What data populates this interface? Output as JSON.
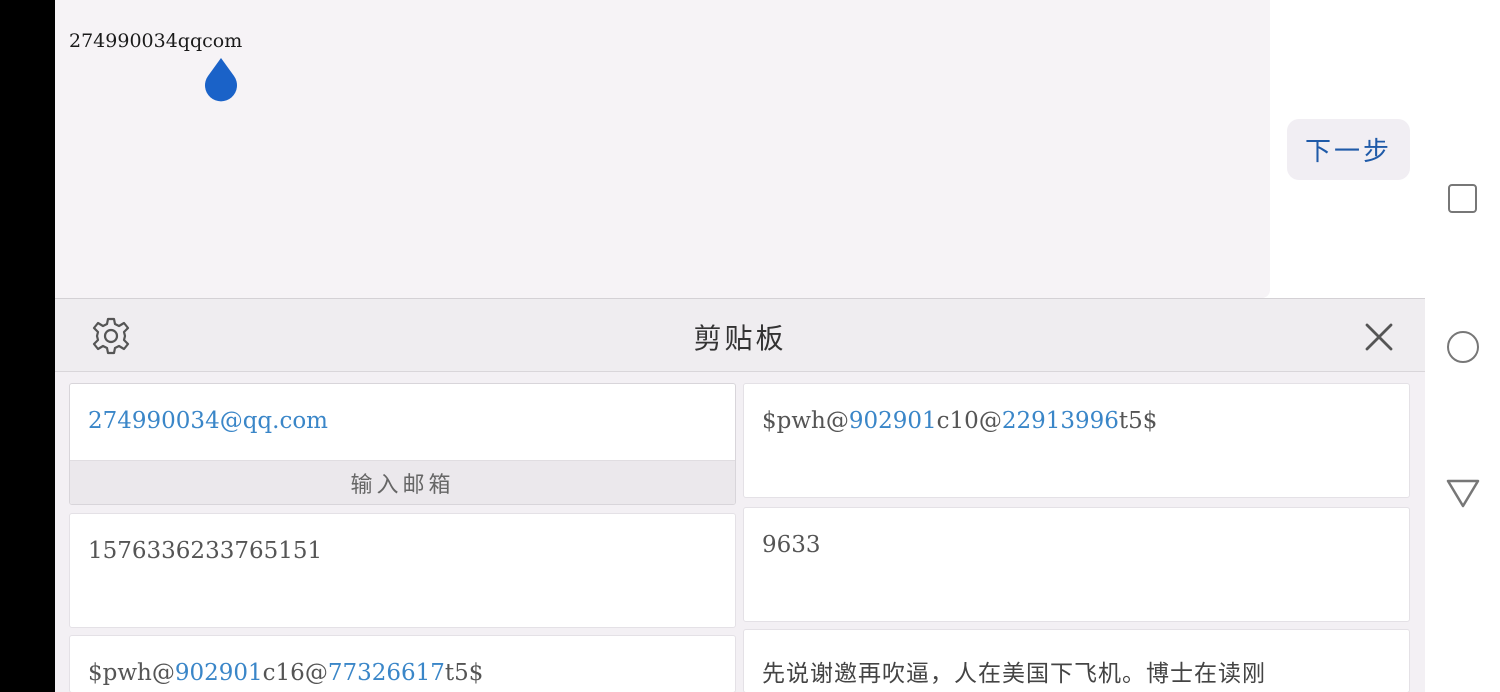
{
  "input": {
    "text": "274990034qqcom"
  },
  "next_button": {
    "label": "下一步"
  },
  "clipboard": {
    "title": "剪贴板",
    "items": [
      {
        "parts": [
          "274990034@qq.com"
        ],
        "highlight": [
          true
        ],
        "action": "输入邮箱"
      },
      {
        "parts": [
          "$pwh@",
          "902901",
          "c10@",
          "22913996",
          "t5$"
        ],
        "highlight": [
          false,
          true,
          false,
          true,
          false
        ]
      },
      {
        "parts": [
          "1576336233765151"
        ],
        "highlight": [
          false
        ]
      },
      {
        "parts": [
          "9633"
        ],
        "highlight": [
          false
        ]
      },
      {
        "parts": [
          "$pwh@",
          "902901",
          "c16@",
          "77326617",
          "t5$"
        ],
        "highlight": [
          false,
          true,
          false,
          true,
          false
        ]
      },
      {
        "parts": [
          "先说谢邀再吹逼，人在美国下飞机。博士在读刚"
        ],
        "highlight": [
          false
        ]
      }
    ]
  },
  "icons": {
    "settings": "gear-icon",
    "close": "close-icon",
    "cursor": "text-cursor-handle-icon",
    "nav_recent": "square-icon",
    "nav_home": "circle-icon",
    "nav_back": "triangle-back-icon"
  },
  "colors": {
    "accent": "#3a86c8",
    "button_text": "#1f5aa8",
    "cursor": "#1a62c8"
  }
}
